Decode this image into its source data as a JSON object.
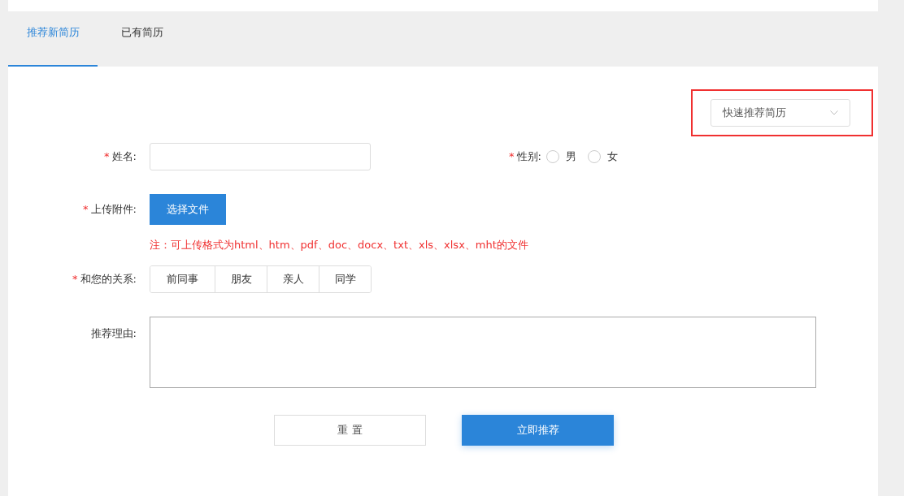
{
  "tabs": [
    {
      "label": "推荐新简历",
      "selected": true
    },
    {
      "label": "已有简历",
      "selected": false
    }
  ],
  "quick_select": {
    "value": "快速推荐简历",
    "highlighted": true
  },
  "form": {
    "name": {
      "mark": "*",
      "label": "姓名:"
    },
    "gender": {
      "mark": "*",
      "label": "性别:",
      "options": [
        {
          "label": "男",
          "selected": false
        },
        {
          "label": "女",
          "selected": false
        }
      ]
    },
    "attachment": {
      "mark": "*",
      "label": "上传附件:",
      "button": "选择文件",
      "note": "注：可上传格式为html、htm、pdf、doc、docx、txt、xls、xlsx、mht的文件"
    },
    "relation": {
      "mark": "*",
      "label": "和您的关系:",
      "options": [
        {
          "label": "前同事",
          "selected": false
        },
        {
          "label": "朋友",
          "selected": false
        },
        {
          "label": "亲人",
          "selected": false
        },
        {
          "label": "同学",
          "selected": false
        }
      ]
    },
    "reason": {
      "label": "推荐理由:"
    }
  },
  "buttons": [
    {
      "label": "重 置",
      "kind": "secondary"
    },
    {
      "label": "立即推荐",
      "kind": "primary"
    }
  ]
}
